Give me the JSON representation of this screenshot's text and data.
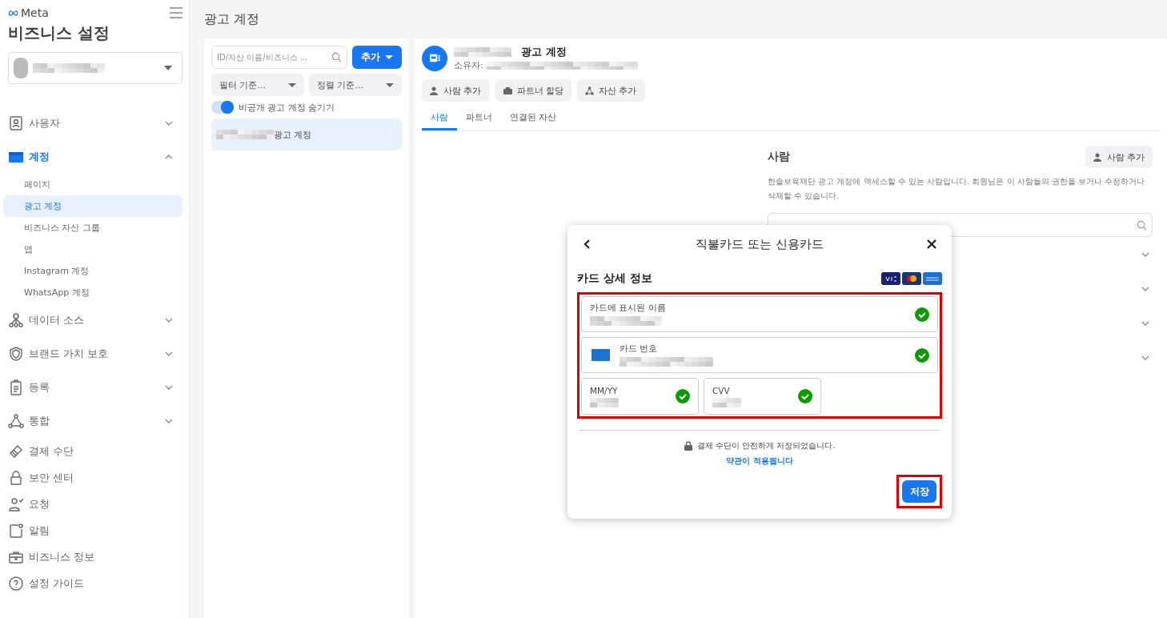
{
  "sidebar": {
    "logo": "Meta",
    "title": "비즈니스 설정",
    "nav": [
      {
        "kind": "group",
        "label": "사용자",
        "expanded": false,
        "selected": false
      },
      {
        "kind": "group",
        "label": "계정",
        "expanded": true,
        "selected": true,
        "children": [
          {
            "label": "페이지",
            "selected": false
          },
          {
            "label": "광고 계정",
            "selected": true
          },
          {
            "label": "비즈니스 자산 그룹",
            "selected": false
          },
          {
            "label": "앱",
            "selected": false
          },
          {
            "label": "Instagram 계정",
            "selected": false
          },
          {
            "label": "WhatsApp 계정",
            "selected": false
          }
        ]
      },
      {
        "kind": "group",
        "label": "데이터 소스",
        "expanded": false,
        "selected": false
      },
      {
        "kind": "group",
        "label": "브랜드 가치 보호",
        "expanded": false,
        "selected": false
      },
      {
        "kind": "group",
        "label": "등록",
        "expanded": false,
        "selected": false
      },
      {
        "kind": "group",
        "label": "통합",
        "expanded": false,
        "selected": false
      },
      {
        "kind": "link",
        "label": "결제 수단",
        "selected": false
      },
      {
        "kind": "link",
        "label": "보안 센터",
        "selected": false
      },
      {
        "kind": "link",
        "label": "요청",
        "selected": false
      },
      {
        "kind": "link",
        "label": "알림",
        "selected": false
      },
      {
        "kind": "link",
        "label": "비즈니스 정보",
        "selected": false
      },
      {
        "kind": "link",
        "label": "설정 가이드",
        "selected": false
      }
    ]
  },
  "page_title": "광고 계정",
  "left_panel": {
    "search": {
      "placeholder": "ID/자산 이름/비즈니스 ..."
    },
    "add_button": "추가",
    "filter": "필터 기준...",
    "sort": "정렬 기준...",
    "toggle": {
      "label": "비공개 광고 계정 숨기기",
      "on": true
    },
    "items": [
      {
        "label": "광고 계정",
        "selected": true
      }
    ]
  },
  "account": {
    "name_suffix": "광고 계정",
    "owner_label": "소유자:",
    "actions": [
      "사람 추가",
      "파트너 할당",
      "자산 추가"
    ],
    "tabs": [
      {
        "label": "사람",
        "selected": true
      },
      {
        "label": "파트너",
        "selected": false
      },
      {
        "label": "연결된 자산",
        "selected": false
      }
    ],
    "section": {
      "title": "사람",
      "button": "사람 추가",
      "description": "한솔보육재단 광고 계정에 액세스할 수 있는 사람입니다. 회원님은 이 사람들의 권한을 보거나 수정하거나 삭제할 수 있습니다."
    }
  },
  "dialog": {
    "title": "직불카드 또는 신용카드",
    "section_title": "카드 상세 정보",
    "fields": [
      {
        "kind": "name",
        "label": "카드에 표시된 이름",
        "valid": true
      },
      {
        "kind": "card",
        "label": "카드 번호",
        "valid": true
      },
      {
        "kind": "small",
        "label": "MM/YY",
        "valid": true
      },
      {
        "kind": "small",
        "label": "CVV",
        "valid": true
      }
    ],
    "secure_note": "결제 수단이 안전하게 저장되었습니다.",
    "terms_link": "약관이 적용됩니다",
    "save_button": "저장"
  }
}
